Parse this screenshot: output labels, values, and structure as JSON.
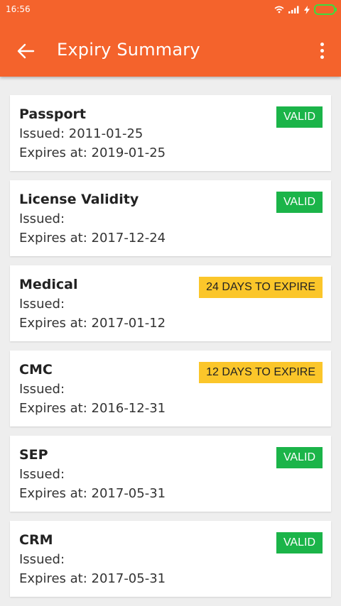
{
  "status_bar": {
    "time": "16:56"
  },
  "header": {
    "title": "Expiry Summary"
  },
  "icons": {
    "back": "arrow-back-icon",
    "more": "more-vert-icon"
  },
  "colors": {
    "appbar": "#f4632c",
    "valid": "#1bb449",
    "warning": "#fbc62a"
  },
  "items": [
    {
      "title": "Passport",
      "issued": "Issued: 2011-01-25",
      "expires": "Expires at: 2019-01-25",
      "status": "VALID"
    },
    {
      "title": "License Validity",
      "issued": "Issued:",
      "expires": "Expires at: 2017-12-24",
      "status": "VALID"
    },
    {
      "title": "Medical",
      "issued": "Issued:",
      "expires": "Expires at: 2017-01-12",
      "status": "24 DAYS TO EXPIRE"
    },
    {
      "title": "CMC",
      "issued": "Issued:",
      "expires": "Expires at: 2016-12-31",
      "status": "12 DAYS TO EXPIRE"
    },
    {
      "title": "SEP",
      "issued": "Issued:",
      "expires": "Expires at: 2017-05-31",
      "status": "VALID"
    },
    {
      "title": "CRM",
      "issued": "Issued:",
      "expires": "Expires at: 2017-05-31",
      "status": "VALID"
    }
  ]
}
